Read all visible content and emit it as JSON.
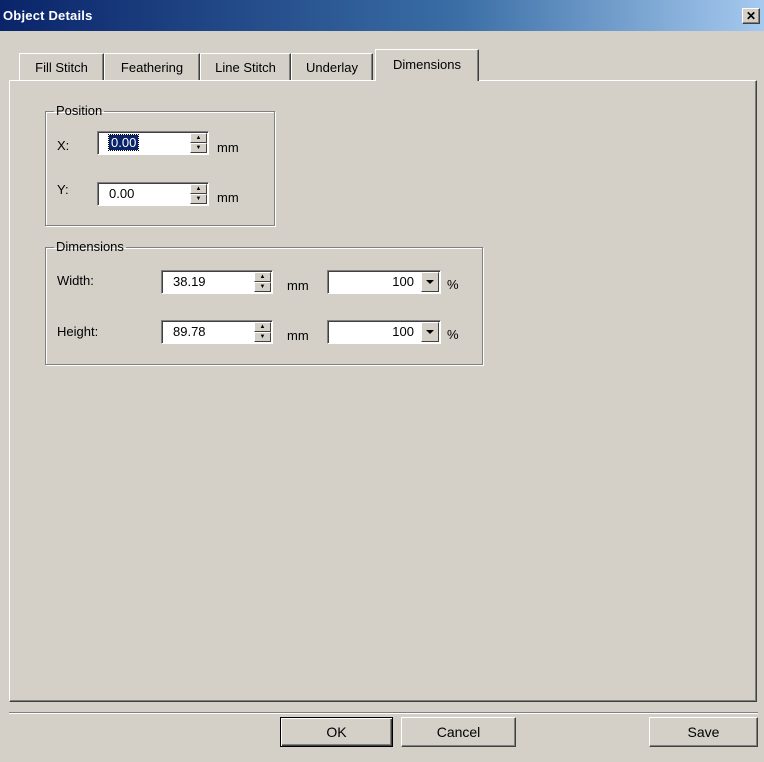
{
  "window": {
    "title": "Object Details",
    "close_icon": "close-icon"
  },
  "tabs": [
    "Fill Stitch",
    "Feathering",
    "Line Stitch",
    "Underlay",
    "Dimensions"
  ],
  "active_tab": "Dimensions",
  "position": {
    "legend": "Position",
    "x_label": "X:",
    "x_value": "0.00",
    "x_unit": "mm",
    "y_label": "Y:",
    "y_value": "0.00",
    "y_unit": "mm"
  },
  "dimensions": {
    "legend": "Dimensions",
    "width_label": "Width:",
    "width_value": "38.19",
    "width_unit": "mm",
    "width_percent": "100",
    "width_percent_unit": "%",
    "height_label": "Height:",
    "height_value": "89.78",
    "height_unit": "mm",
    "height_percent": "100",
    "height_percent_unit": "%"
  },
  "buttons": {
    "ok": "OK",
    "cancel": "Cancel",
    "save": "Save"
  },
  "colors": {
    "titlebar_start": "#0a246a",
    "titlebar_end": "#a6caf0",
    "face": "#d4d0c8",
    "selection": "#0a246a"
  }
}
